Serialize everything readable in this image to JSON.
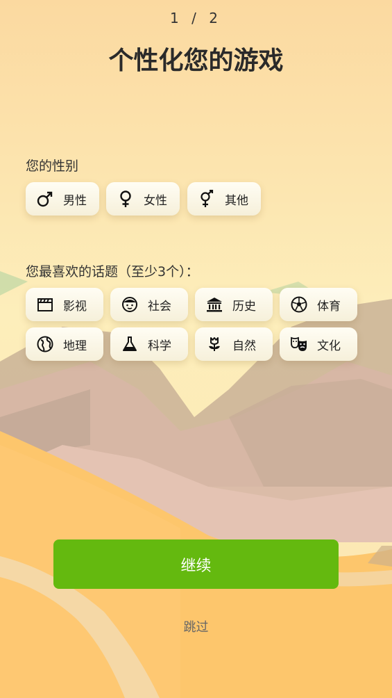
{
  "header": {
    "progress": "1 / 2",
    "title": "个性化您的游戏"
  },
  "gender": {
    "label": "您的性别",
    "options": [
      {
        "label": "男性",
        "icon": "male-symbol-icon"
      },
      {
        "label": "女性",
        "icon": "female-symbol-icon"
      },
      {
        "label": "其他",
        "icon": "other-gender-symbol-icon"
      }
    ]
  },
  "topics": {
    "label": "您最喜欢的话题（至少3个）：",
    "options": [
      {
        "label": "影视",
        "icon": "clapperboard-icon"
      },
      {
        "label": "社会",
        "icon": "face-icon"
      },
      {
        "label": "历史",
        "icon": "museum-icon"
      },
      {
        "label": "体育",
        "icon": "soccer-ball-icon"
      },
      {
        "label": "地理",
        "icon": "globe-icon"
      },
      {
        "label": "科学",
        "icon": "flask-icon"
      },
      {
        "label": "自然",
        "icon": "flower-icon"
      },
      {
        "label": "文化",
        "icon": "theater-masks-icon"
      }
    ]
  },
  "actions": {
    "continue_label": "继续",
    "skip_label": "跳过"
  },
  "colors": {
    "accent": "#64b90f",
    "background": "#fbe6b1"
  }
}
